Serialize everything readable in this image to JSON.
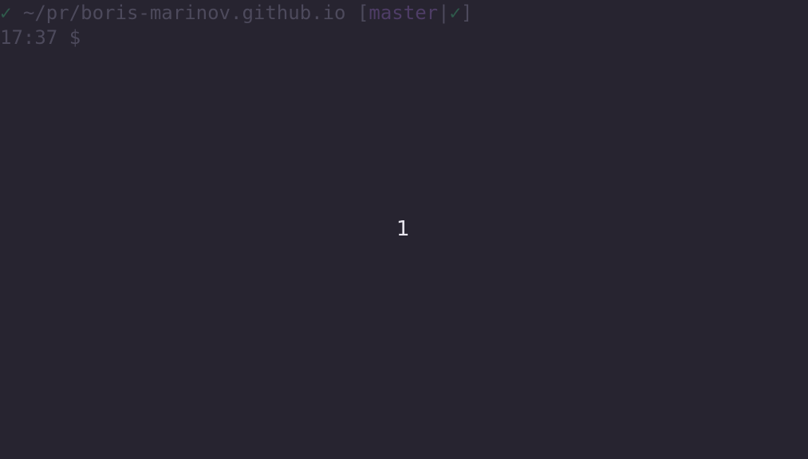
{
  "terminal": {
    "status_check": "✓",
    "cwd": "~/pr/boris-marinov.github.io",
    "branch_open": "[",
    "branch_name": "master",
    "branch_sep": "|",
    "branch_check": "✓",
    "branch_close": "]",
    "time": "17:37",
    "prompt_symbol": "$"
  },
  "overlay": {
    "number": "1"
  },
  "colors": {
    "background": "#272430",
    "prompt_text": "#4d4a5c",
    "check": "#2f5a4b",
    "branch": "#4e3d66",
    "overlay_number": "#e8e6ee"
  }
}
